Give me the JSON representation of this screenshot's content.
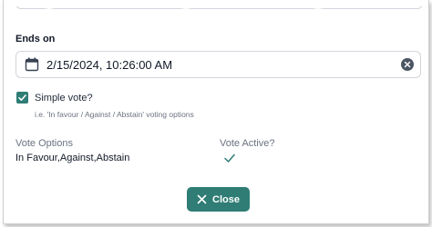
{
  "ends_on": {
    "label": "Ends on",
    "value": "2/15/2024, 10:26:00 AM"
  },
  "simple_vote": {
    "label": "Simple vote?",
    "checked": true,
    "hint": "i.e. 'In favour / Against / Abstain' voting options"
  },
  "vote_options": {
    "label": "Vote Options",
    "value": "In Favour,Against,Abstain"
  },
  "vote_active": {
    "label": "Vote Active?",
    "value_icon": "check-icon"
  },
  "close_button": {
    "label": "Close",
    "icon": "close-icon"
  },
  "colors": {
    "accent": "#2f7d75",
    "muted_text": "#6b7280",
    "border": "#d1d5db"
  }
}
